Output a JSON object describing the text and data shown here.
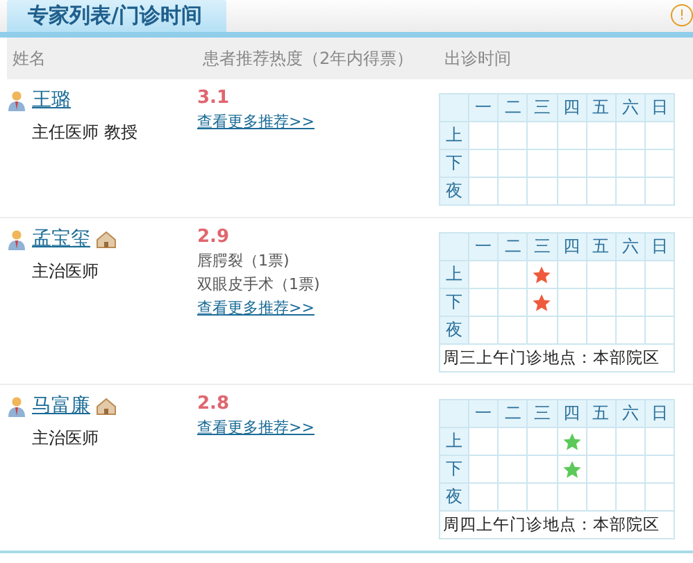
{
  "tab": {
    "label": "专家列表/门诊时间",
    "selected": true
  },
  "info_icon": "!",
  "columns": [
    "姓名",
    "患者推荐热度（2年内得票）",
    "出诊时间"
  ],
  "doctors": [
    {
      "name": "王璐",
      "home": false,
      "title": "主任医师 教授",
      "score": "3.1",
      "more": "查看更多推荐>>",
      "weekdays": [
        "一",
        "二",
        "三",
        "四",
        "五",
        "六",
        "日"
      ],
      "slots": [
        {
          "label": "上",
          "cells": [
            {
              "star": false
            },
            {
              "star": false
            },
            {
              "star": false
            },
            {
              "star": false
            },
            {
              "star": false
            },
            {
              "star": false
            },
            {
              "star": false
            }
          ]
        },
        {
          "label": "下",
          "cells": [
            {
              "star": false
            },
            {
              "star": false
            },
            {
              "star": false
            },
            {
              "star": false
            },
            {
              "star": false
            },
            {
              "star": false
            },
            {
              "star": false
            }
          ]
        },
        {
          "label": "夜",
          "cells": [
            {
              "star": false
            },
            {
              "star": false
            },
            {
              "star": false
            },
            {
              "star": false
            },
            {
              "star": false
            },
            {
              "star": false
            },
            {
              "star": false
            }
          ]
        }
      ]
    },
    {
      "name": "孟宝玺",
      "home": true,
      "title": "主治医师",
      "score": "2.9",
      "votes": [
        "唇腭裂（1票)",
        "双眼皮手术（1票)"
      ],
      "more": "查看更多推荐>>",
      "weekdays": [
        "一",
        "二",
        "三",
        "四",
        "五",
        "六",
        "日"
      ],
      "slots": [
        {
          "label": "上",
          "cells": [
            {
              "star": false
            },
            {
              "star": false
            },
            {
              "star": true,
              "color": "#ef5a3c"
            },
            {
              "star": false
            },
            {
              "star": false
            },
            {
              "star": false
            },
            {
              "star": false
            }
          ]
        },
        {
          "label": "下",
          "cells": [
            {
              "star": false
            },
            {
              "star": false
            },
            {
              "star": true,
              "color": "#ef5a3c"
            },
            {
              "star": false
            },
            {
              "star": false
            },
            {
              "star": false
            },
            {
              "star": false
            }
          ]
        },
        {
          "label": "夜",
          "cells": [
            {
              "star": false
            },
            {
              "star": false
            },
            {
              "star": false
            },
            {
              "star": false
            },
            {
              "star": false
            },
            {
              "star": false
            },
            {
              "star": false
            }
          ]
        }
      ],
      "note": "周三上午门诊地点：本部院区"
    },
    {
      "name": "马富廉",
      "home": true,
      "title": "主治医师",
      "score": "2.8",
      "more": "查看更多推荐>>",
      "weekdays": [
        "一",
        "二",
        "三",
        "四",
        "五",
        "六",
        "日"
      ],
      "slots": [
        {
          "label": "上",
          "cells": [
            {
              "star": false
            },
            {
              "star": false
            },
            {
              "star": false
            },
            {
              "star": true,
              "color": "#5cc95a"
            },
            {
              "star": false
            },
            {
              "star": false
            },
            {
              "star": false
            }
          ]
        },
        {
          "label": "下",
          "cells": [
            {
              "star": false
            },
            {
              "star": false
            },
            {
              "star": false
            },
            {
              "star": true,
              "color": "#5cc95a"
            },
            {
              "star": false
            },
            {
              "star": false
            },
            {
              "star": false
            }
          ]
        },
        {
          "label": "夜",
          "cells": [
            {
              "star": false
            },
            {
              "star": false
            },
            {
              "star": false
            },
            {
              "star": false
            },
            {
              "star": false
            },
            {
              "star": false
            },
            {
              "star": false
            }
          ]
        }
      ],
      "note": "周四上午门诊地点：本部院区"
    }
  ]
}
